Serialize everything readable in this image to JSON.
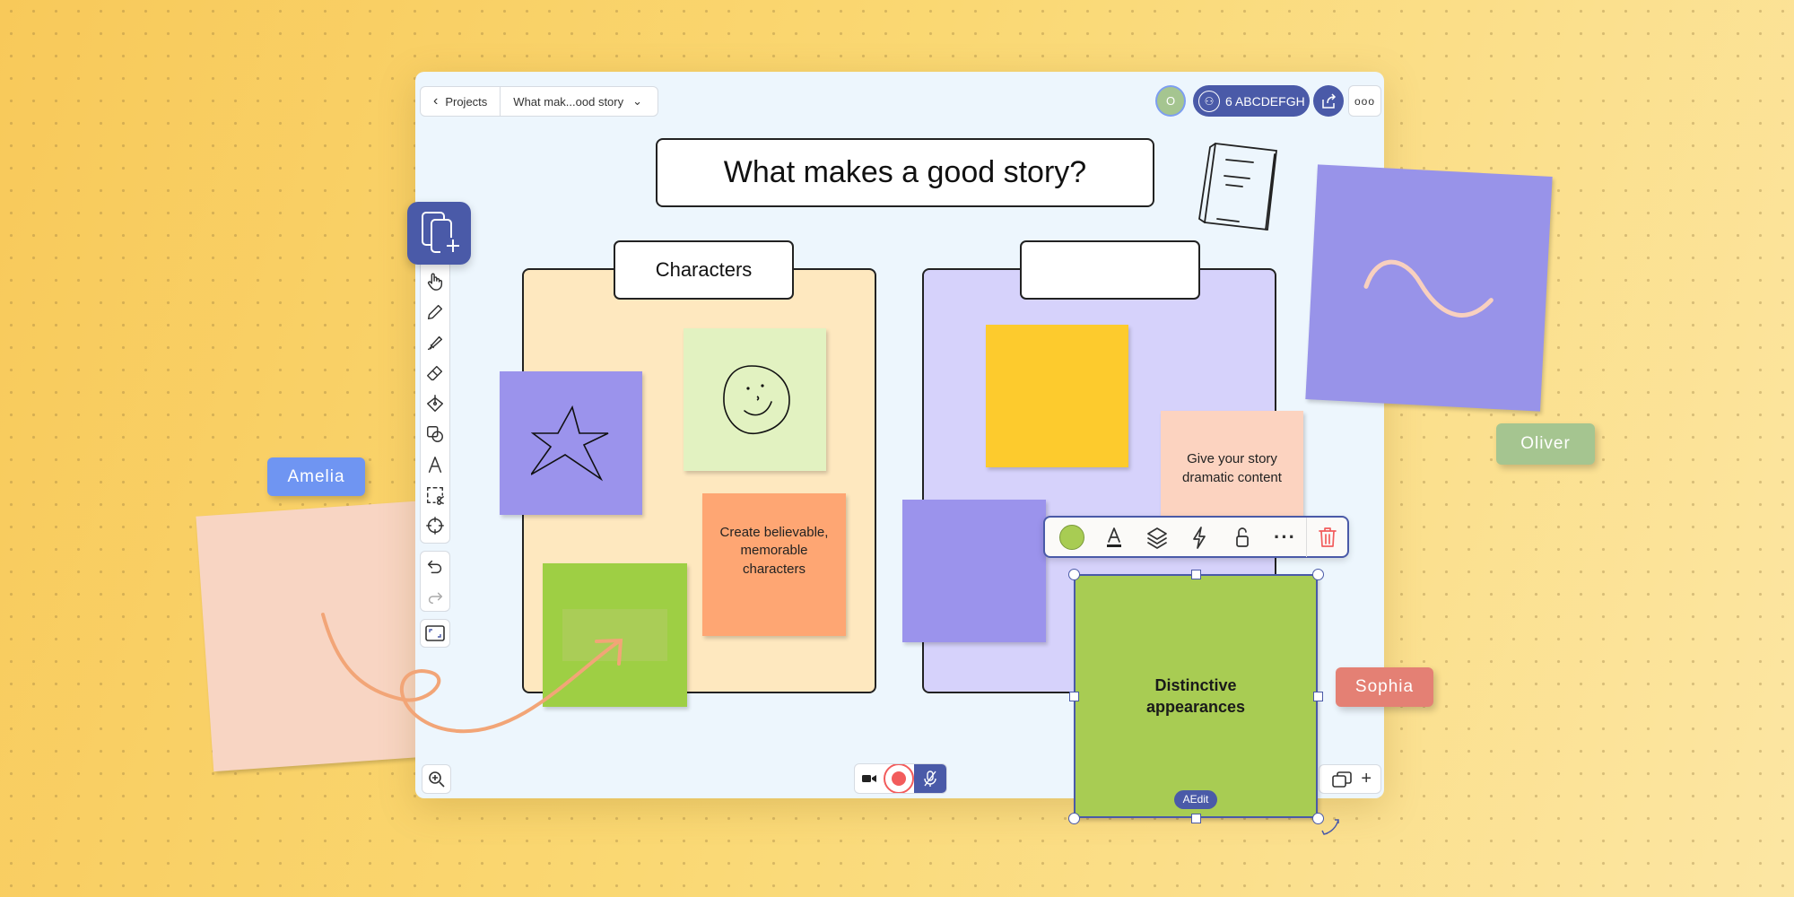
{
  "nav": {
    "back_label": "Projects",
    "board_name": "What mak...ood story"
  },
  "header": {
    "avatar_initial": "O",
    "share_label": "6 ABCDEFGH"
  },
  "board": {
    "title": "What makes a good story?",
    "sections": [
      {
        "label": "Characters",
        "color": "#fee8bf"
      },
      {
        "label": "",
        "color": "#d6d2fb"
      }
    ],
    "notes": {
      "orange": "Create believable, memorable characters",
      "peach": "Give your story dramatic content",
      "selected": "Distinctive appearances"
    }
  },
  "selection": {
    "edit_label": "Edit",
    "color": "#a8cc53"
  },
  "cursors": [
    {
      "name": "Amelia",
      "color": "#6f95f2"
    },
    {
      "name": "Oliver",
      "color": "#a5c590"
    },
    {
      "name": "Sophia",
      "color": "#e48074"
    }
  ],
  "colors": {
    "accent": "#4a5aa8",
    "record": "#f25c5c"
  }
}
